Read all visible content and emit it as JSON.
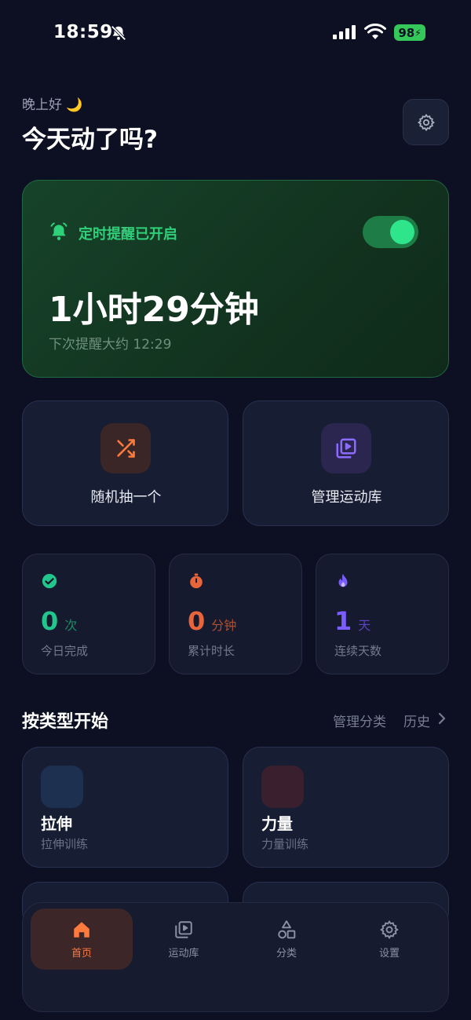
{
  "status_bar": {
    "time": "18:59",
    "battery": "98"
  },
  "header": {
    "greeting": "晚上好 🌙",
    "title": "今天动了吗?"
  },
  "timer_card": {
    "label": "定时提醒已开启",
    "toggle_on": true,
    "countdown": "1小时29分钟",
    "next_reminder": "下次提醒大约 12:29",
    "accent_color": "#2fd07a"
  },
  "actions": [
    {
      "label": "随机抽一个",
      "icon": "shuffle-icon",
      "color": "#ff7a3d"
    },
    {
      "label": "管理运动库",
      "icon": "video-library-icon",
      "color": "#8b6cff"
    }
  ],
  "stats": [
    {
      "value": "0",
      "unit": "次",
      "label": "今日完成",
      "icon": "check-circle-icon",
      "color": "#22c58b"
    },
    {
      "value": "0",
      "unit": "分钟",
      "label": "累计时长",
      "icon": "stopwatch-icon",
      "color": "#e8643a"
    },
    {
      "value": "1",
      "unit": "天",
      "label": "连续天数",
      "icon": "flame-icon",
      "color": "#7a5cff"
    }
  ],
  "section": {
    "title": "按类型开始",
    "manage_label": "管理分类",
    "history_label": "历史"
  },
  "categories": [
    {
      "name": "拉伸",
      "subtitle": "拉伸训练",
      "color": "#1e3050"
    },
    {
      "name": "力量",
      "subtitle": "力量训练",
      "color": "#3a1f2e"
    }
  ],
  "tabs": [
    {
      "label": "首页",
      "icon": "home-icon",
      "active": true
    },
    {
      "label": "运动库",
      "icon": "video-library-icon",
      "active": false
    },
    {
      "label": "分类",
      "icon": "shapes-icon",
      "active": false
    },
    {
      "label": "设置",
      "icon": "gear-icon",
      "active": false
    }
  ]
}
